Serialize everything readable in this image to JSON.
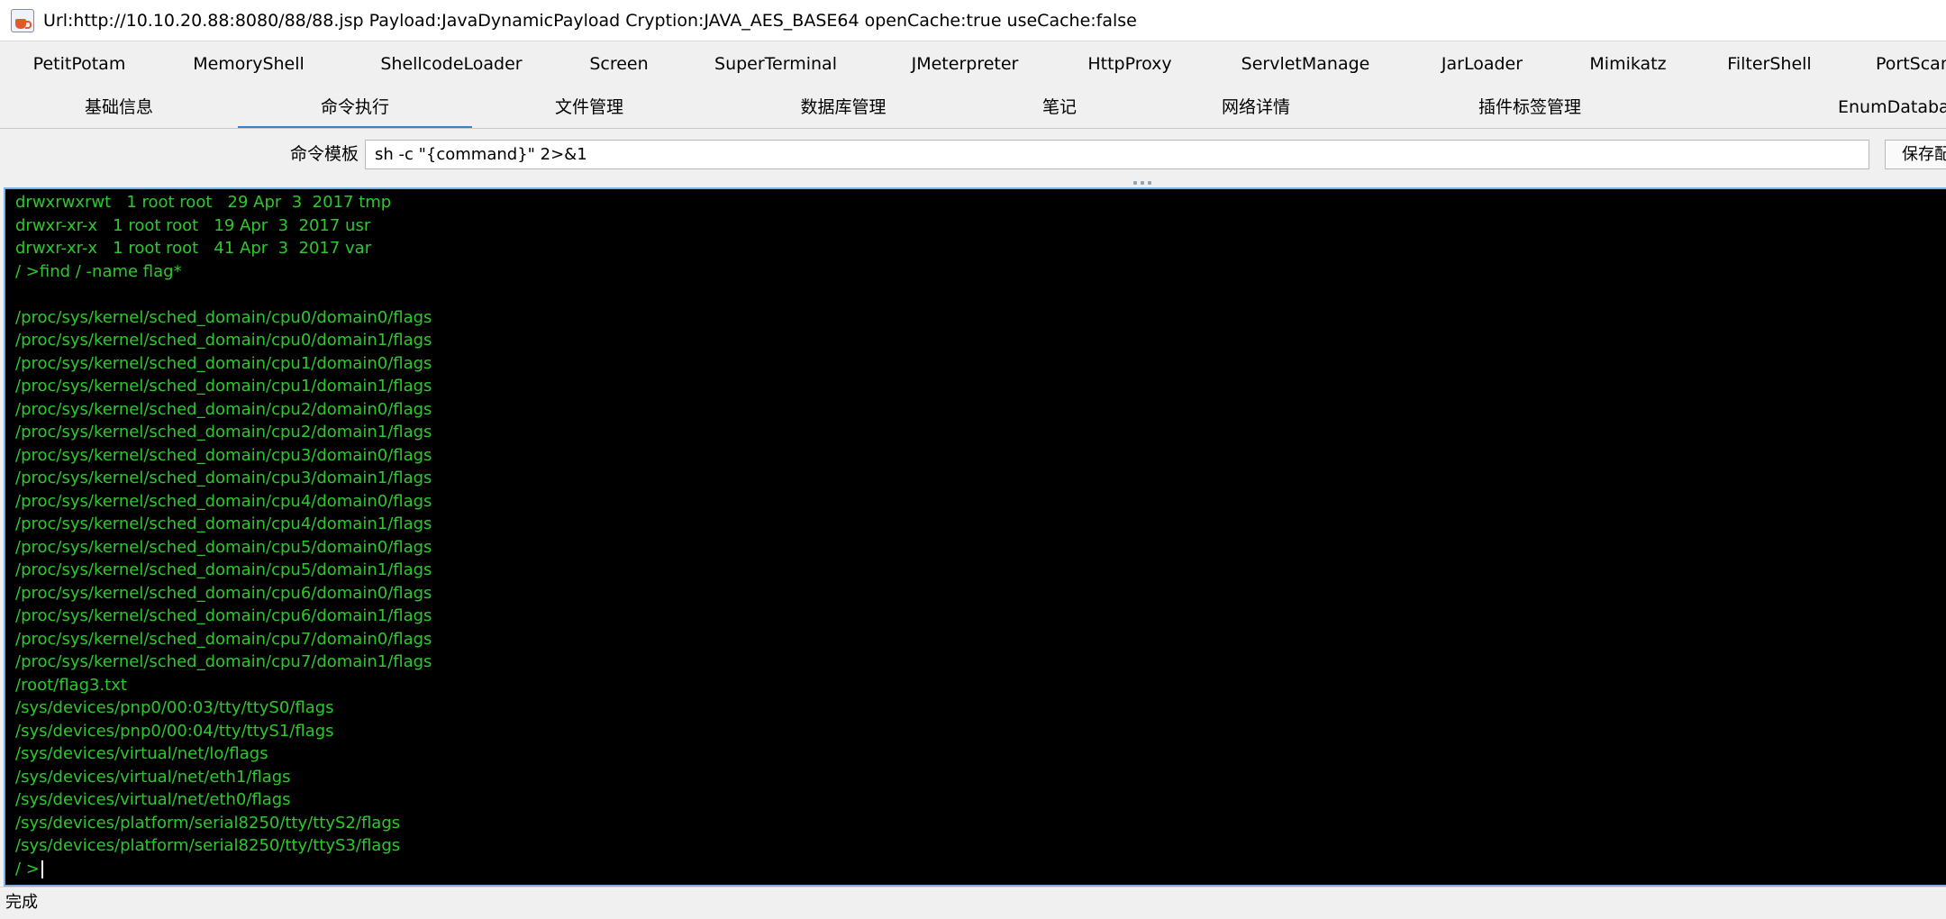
{
  "window": {
    "title": "Url:http://10.10.20.88:8080/88/88.jsp Payload:JavaDynamicPayload Cryption:JAVA_AES_BASE64 openCache:true useCache:false"
  },
  "plugin_tabs": [
    {
      "label": "PetitPotam"
    },
    {
      "label": "MemoryShell"
    },
    {
      "label": "ShellcodeLoader"
    },
    {
      "label": "Screen"
    },
    {
      "label": "SuperTerminal"
    },
    {
      "label": "JMeterpreter"
    },
    {
      "label": "HttpProxy"
    },
    {
      "label": "ServletManage"
    },
    {
      "label": "JarLoader"
    },
    {
      "label": "Mimikatz"
    },
    {
      "label": "FilterShell"
    },
    {
      "label": "PortScan"
    }
  ],
  "main_tabs": [
    {
      "label": "基础信息"
    },
    {
      "label": "命令执行",
      "active": true
    },
    {
      "label": "文件管理"
    },
    {
      "label": "数据库管理"
    },
    {
      "label": "笔记"
    },
    {
      "label": "网络详情"
    },
    {
      "label": "插件标签管理"
    },
    {
      "label": "EnumDatabase"
    }
  ],
  "command_template": {
    "label": "命令模板",
    "value": "sh -c \"{command}\" 2>&1",
    "save_label": "保存配置"
  },
  "terminal": {
    "lines": [
      "drwxrwxrwt   1 root root   29 Apr  3  2017 tmp",
      "drwxr-xr-x   1 root root   19 Apr  3  2017 usr",
      "drwxr-xr-x   1 root root   41 Apr  3  2017 var",
      "/ >find / -name flag*",
      "",
      "/proc/sys/kernel/sched_domain/cpu0/domain0/flags",
      "/proc/sys/kernel/sched_domain/cpu0/domain1/flags",
      "/proc/sys/kernel/sched_domain/cpu1/domain0/flags",
      "/proc/sys/kernel/sched_domain/cpu1/domain1/flags",
      "/proc/sys/kernel/sched_domain/cpu2/domain0/flags",
      "/proc/sys/kernel/sched_domain/cpu2/domain1/flags",
      "/proc/sys/kernel/sched_domain/cpu3/domain0/flags",
      "/proc/sys/kernel/sched_domain/cpu3/domain1/flags",
      "/proc/sys/kernel/sched_domain/cpu4/domain0/flags",
      "/proc/sys/kernel/sched_domain/cpu4/domain1/flags",
      "/proc/sys/kernel/sched_domain/cpu5/domain0/flags",
      "/proc/sys/kernel/sched_domain/cpu5/domain1/flags",
      "/proc/sys/kernel/sched_domain/cpu6/domain0/flags",
      "/proc/sys/kernel/sched_domain/cpu6/domain1/flags",
      "/proc/sys/kernel/sched_domain/cpu7/domain0/flags",
      "/proc/sys/kernel/sched_domain/cpu7/domain1/flags",
      "/root/flag3.txt",
      "/sys/devices/pnp0/00:03/tty/ttyS0/flags",
      "/sys/devices/pnp0/00:04/tty/ttyS1/flags",
      "/sys/devices/virtual/net/lo/flags",
      "/sys/devices/virtual/net/eth1/flags",
      "/sys/devices/virtual/net/eth0/flags",
      "/sys/devices/platform/serial8250/tty/ttyS2/flags",
      "/sys/devices/platform/serial8250/tty/ttyS3/flags"
    ],
    "prompt": "/ >"
  },
  "status": {
    "text": "完成"
  },
  "colors": {
    "terminal_bg": "#000000",
    "terminal_fg": "#2ec82e",
    "accent": "#3d80c8"
  }
}
